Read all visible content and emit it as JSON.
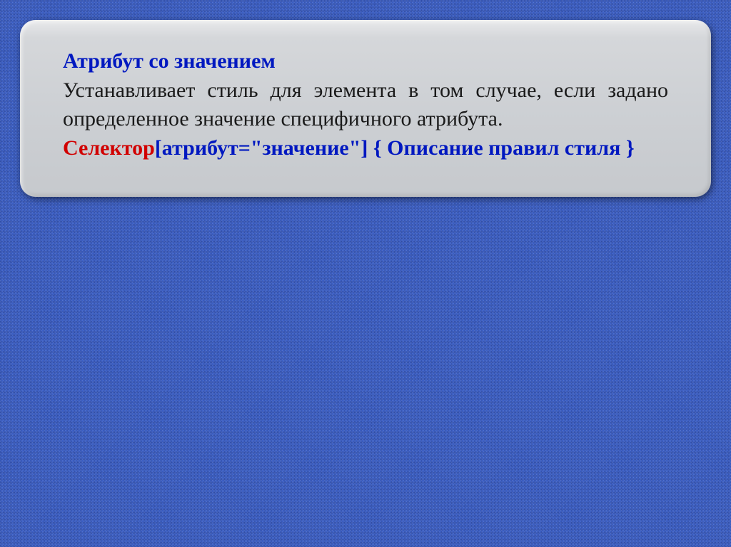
{
  "slide": {
    "heading": "Атрибут со значением",
    "description": "Устанавливает стиль для элемента в том случае, если задано определенное значение специфичного атрибута.",
    "syntax": {
      "selector": "Селектор",
      "rest": "[атрибут=\"значение\"] { Описание правил стиля }"
    }
  }
}
